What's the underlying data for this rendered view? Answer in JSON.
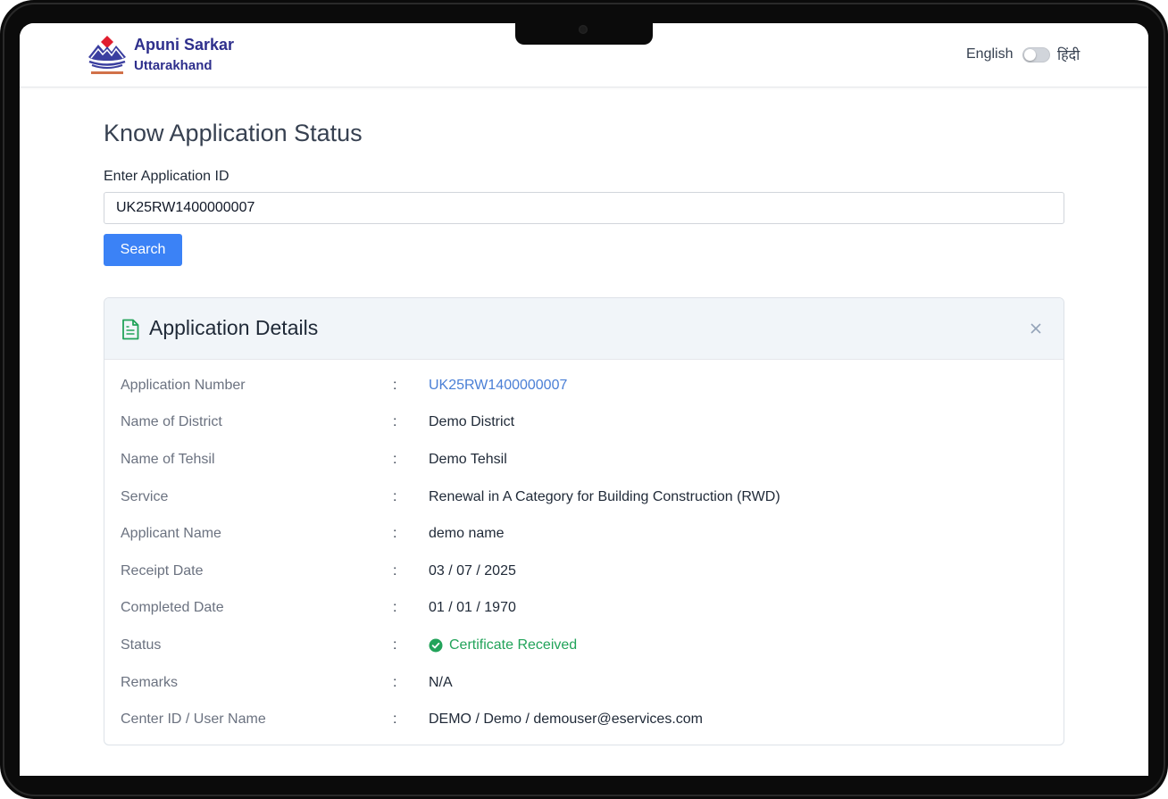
{
  "header": {
    "brand_title": "Apuni Sarkar",
    "brand_subtitle": "Uttarakhand",
    "language": {
      "english_label": "English",
      "hindi_label": "हिंदी",
      "toggle_state": "english"
    }
  },
  "page": {
    "title": "Know Application Status",
    "input_label": "Enter Application ID",
    "input_value": "UK25RW1400000007",
    "search_label": "Search"
  },
  "card": {
    "title": "Application Details",
    "icon": "document-icon",
    "close_icon": "close-icon",
    "separator": ":",
    "rows": [
      {
        "label": "Application Number",
        "value": "UK25RW1400000007"
      },
      {
        "label": "Name of District",
        "value": "Demo District"
      },
      {
        "label": "Name of Tehsil",
        "value": "Demo Tehsil"
      },
      {
        "label": "Service",
        "value": "Renewal in A Category for Building Construction (RWD)"
      },
      {
        "label": "Applicant Name",
        "value": "demo name"
      },
      {
        "label": "Receipt Date",
        "value": "03 / 07 / 2025"
      },
      {
        "label": "Completed Date",
        "value": "01 / 01 / 1970"
      },
      {
        "label": "Status",
        "value": "Certificate Received"
      },
      {
        "label": "Remarks",
        "value": "N/A"
      },
      {
        "label": "Center ID / User Name",
        "value": "DEMO / Demo / demouser@eservices.com"
      }
    ]
  },
  "colors": {
    "brand": "#2e2f8c",
    "accent": "#3b82f6",
    "link": "#4a7fd6",
    "success": "#22a35a"
  }
}
